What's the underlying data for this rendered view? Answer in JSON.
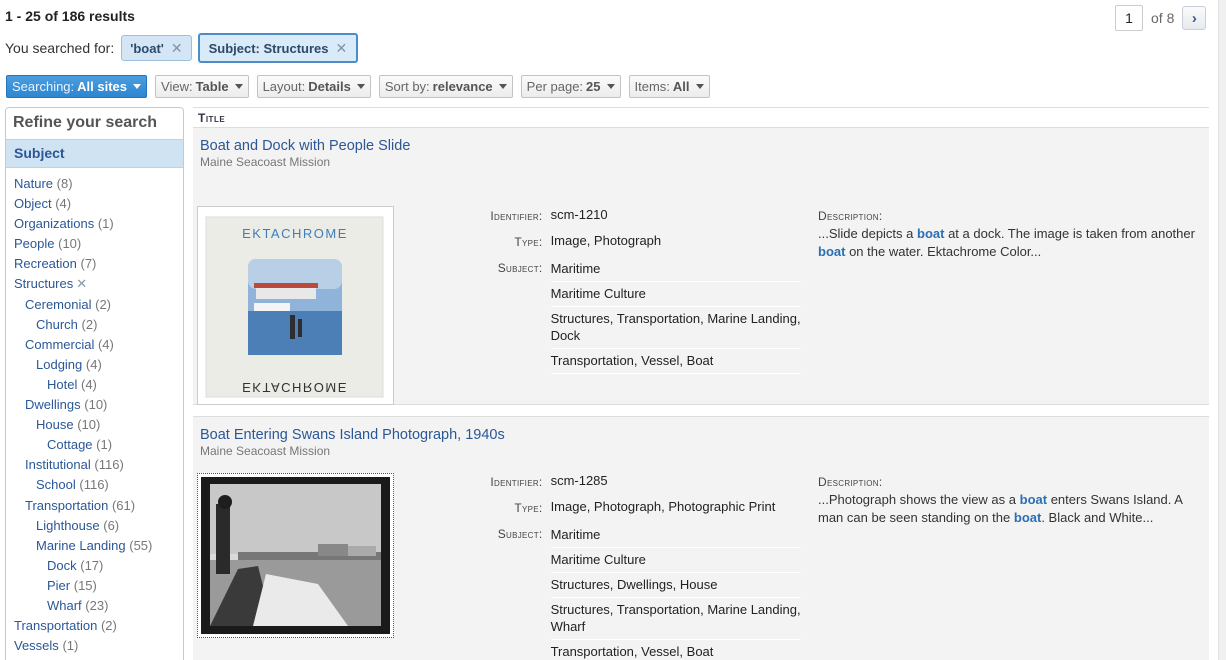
{
  "results_count": "1 - 25 of 186 results",
  "pager": {
    "current_page": "1",
    "of_text": "of 8",
    "next_icon": "chevron-right"
  },
  "search": {
    "label": "You searched for:",
    "chips": [
      {
        "text": "'boat'",
        "remove": "✕"
      },
      {
        "text": "Subject: Structures",
        "remove": "✕"
      }
    ]
  },
  "toolbar": {
    "searching": {
      "label": "Searching:",
      "value": "All sites"
    },
    "view": {
      "label": "View:",
      "value": "Table"
    },
    "layout": {
      "label": "Layout:",
      "value": "Details"
    },
    "sort": {
      "label": "Sort by:",
      "value": "relevance"
    },
    "per_page": {
      "label": "Per page:",
      "value": "25"
    },
    "items": {
      "label": "Items:",
      "value": "All"
    }
  },
  "sidebar": {
    "heading": "Refine your search",
    "facet_group": "Subject",
    "facets": [
      {
        "label": "Nature",
        "count": "(8)",
        "level": 0
      },
      {
        "label": "Object",
        "count": "(4)",
        "level": 0
      },
      {
        "label": "Organizations",
        "count": "(1)",
        "level": 0
      },
      {
        "label": "People",
        "count": "(10)",
        "level": 0
      },
      {
        "label": "Recreation",
        "count": "(7)",
        "level": 0
      },
      {
        "label": "Structures",
        "count": "",
        "level": 0,
        "removable": true
      },
      {
        "label": "Ceremonial",
        "count": "(2)",
        "level": 1
      },
      {
        "label": "Church",
        "count": "(2)",
        "level": 2
      },
      {
        "label": "Commercial",
        "count": "(4)",
        "level": 1
      },
      {
        "label": "Lodging",
        "count": "(4)",
        "level": 2
      },
      {
        "label": "Hotel",
        "count": "(4)",
        "level": 3
      },
      {
        "label": "Dwellings",
        "count": "(10)",
        "level": 1
      },
      {
        "label": "House",
        "count": "(10)",
        "level": 2
      },
      {
        "label": "Cottage",
        "count": "(1)",
        "level": 3
      },
      {
        "label": "Institutional",
        "count": "(116)",
        "level": 1
      },
      {
        "label": "School",
        "count": "(116)",
        "level": 2
      },
      {
        "label": "Transportation",
        "count": "(61)",
        "level": 1
      },
      {
        "label": "Lighthouse",
        "count": "(6)",
        "level": 2
      },
      {
        "label": "Marine Landing",
        "count": "(55)",
        "level": 2
      },
      {
        "label": "Dock",
        "count": "(17)",
        "level": 3
      },
      {
        "label": "Pier",
        "count": "(15)",
        "level": 3
      },
      {
        "label": "Wharf",
        "count": "(23)",
        "level": 3
      },
      {
        "label": "Transportation",
        "count": "(2)",
        "level": 0
      },
      {
        "label": "Vessels",
        "count": "(1)",
        "level": 0
      }
    ]
  },
  "table": {
    "column_title": "Title"
  },
  "results": [
    {
      "title": "Boat and Dock with People Slide",
      "source": "Maine Seacoast Mission",
      "identifier_label": "Identifier:",
      "identifier": "scm-1210",
      "type_label": "Type:",
      "type": "Image, Photograph",
      "subject_label": "Subject:",
      "subjects": [
        "Maritime",
        "Maritime Culture",
        "Structures, Transportation, Marine Landing, Dock",
        "Transportation, Vessel, Boat"
      ],
      "description_label": "Description:",
      "description_parts": [
        "...Slide depicts a ",
        "boat",
        " at a dock. The image is taken from another ",
        "boat",
        " on the water. Ektachrome Color..."
      ],
      "thumb_text_top": "EKTACHROME",
      "thumb_text_bottom": "EKTACHROME"
    },
    {
      "title": "Boat Entering Swans Island Photograph, 1940s",
      "source": "Maine Seacoast Mission",
      "identifier_label": "Identifier:",
      "identifier": "scm-1285",
      "type_label": "Type:",
      "type": "Image, Photograph, Photographic Print",
      "subject_label": "Subject:",
      "subjects": [
        "Maritime",
        "Maritime Culture",
        "Structures, Dwellings, House",
        "Structures, Transportation, Marine Landing, Wharf",
        "Transportation, Vessel, Boat"
      ],
      "description_label": "Description:",
      "description_parts": [
        "...Photograph shows the view as a ",
        "boat",
        " enters Swans Island. A man can be seen standing on the ",
        "boat",
        ". Black and White..."
      ]
    }
  ],
  "colors": {
    "link": "#2b5797",
    "primary_button": "#3a8fd6",
    "facet_header_bg": "#cfe3f3",
    "result_bg": "#f3f3f3",
    "highlight": "#2b6fb3"
  }
}
